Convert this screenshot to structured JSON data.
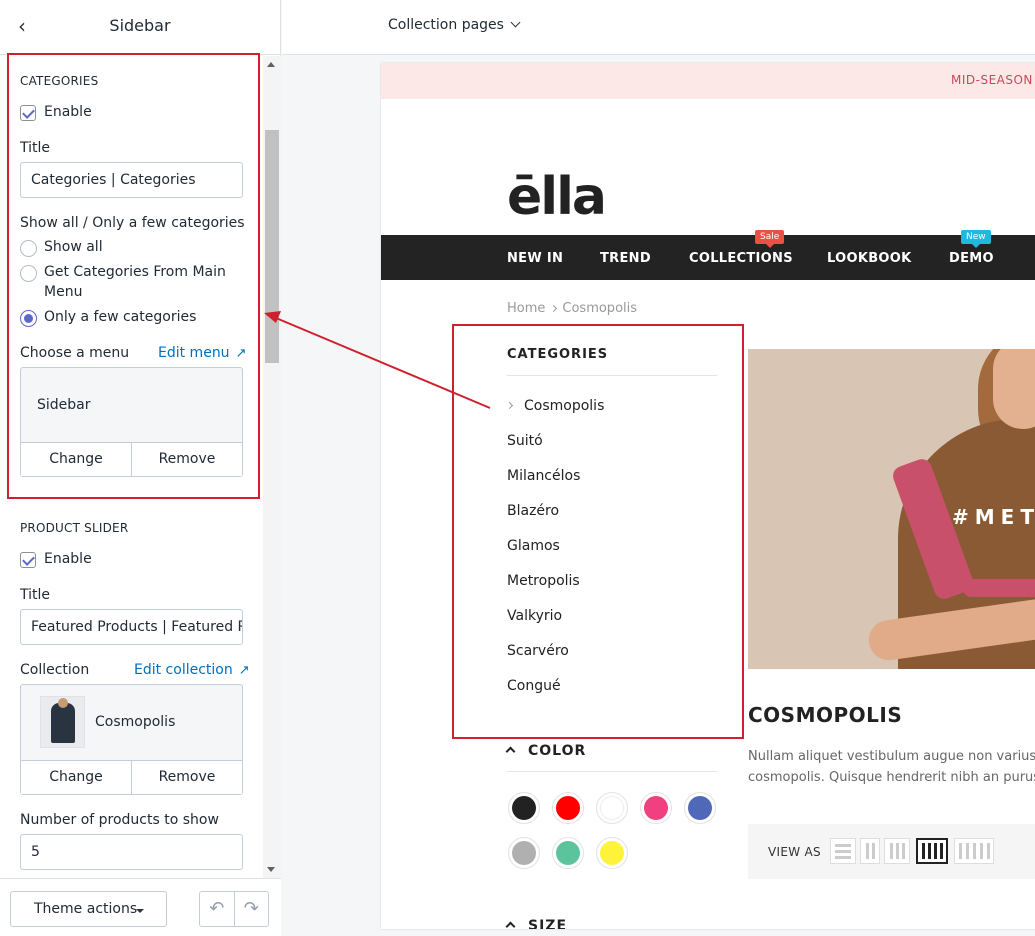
{
  "sidebar_panel": {
    "title": "Sidebar",
    "categories": {
      "heading": "CATEGORIES",
      "enable_label": "Enable",
      "title_label": "Title",
      "title_value": "Categories | Categories",
      "show_label": "Show all / Only a few categories",
      "options": [
        "Show all",
        "Get Categories From Main",
        "Menu",
        "Only a few categories"
      ],
      "choose_menu_label": "Choose a menu",
      "edit_menu_link": "Edit menu",
      "menu_name": "Sidebar",
      "change_label": "Change",
      "remove_label": "Remove"
    },
    "product_slider": {
      "heading": "PRODUCT SLIDER",
      "enable_label": "Enable",
      "title_label": "Title",
      "title_value": "Featured Products | Featured Pro",
      "collection_label": "Collection",
      "edit_collection_link": "Edit collection",
      "collection_name": "Cosmopolis",
      "change_label": "Change",
      "remove_label": "Remove",
      "num_label": "Number of products to show",
      "num_value": "5"
    },
    "footer": {
      "theme_actions": "Theme actions"
    }
  },
  "topbar": {
    "page_select": "Collection pages"
  },
  "preview": {
    "announcement": "MID-SEASON",
    "logo": "ēlla",
    "nav": [
      "NEW IN",
      "TREND",
      "COLLECTIONS",
      "LOOKBOOK",
      "DEMO"
    ],
    "badges": {
      "sale": "Sale",
      "new": "New"
    },
    "breadcrumb": {
      "home": "Home",
      "current": "Cosmopolis"
    },
    "categories_title": "CATEGORIES",
    "categories": [
      "Cosmopolis",
      "Suitó",
      "Milancélos",
      "Blazéro",
      "Glamos",
      "Metropolis",
      "Valkyrio",
      "Scarvéro",
      "Congué"
    ],
    "hero_text": "#MET",
    "collection_title": "COSMOPOLIS",
    "collection_desc": [
      "Nullam aliquet vestibulum augue non varius. Cra",
      "cosmopolis. Quisque hendrerit nibh an purus"
    ],
    "color_heading": "COLOR",
    "colors": [
      "#222222",
      "#ff0000",
      "#ffffff",
      "#f0407f",
      "#5068b8",
      "#b0b0b0",
      "#5cc49c",
      "#fff23a"
    ],
    "view_as": "VIEW AS",
    "size_heading": "SIZE"
  },
  "annotation_color": "#d0202e"
}
